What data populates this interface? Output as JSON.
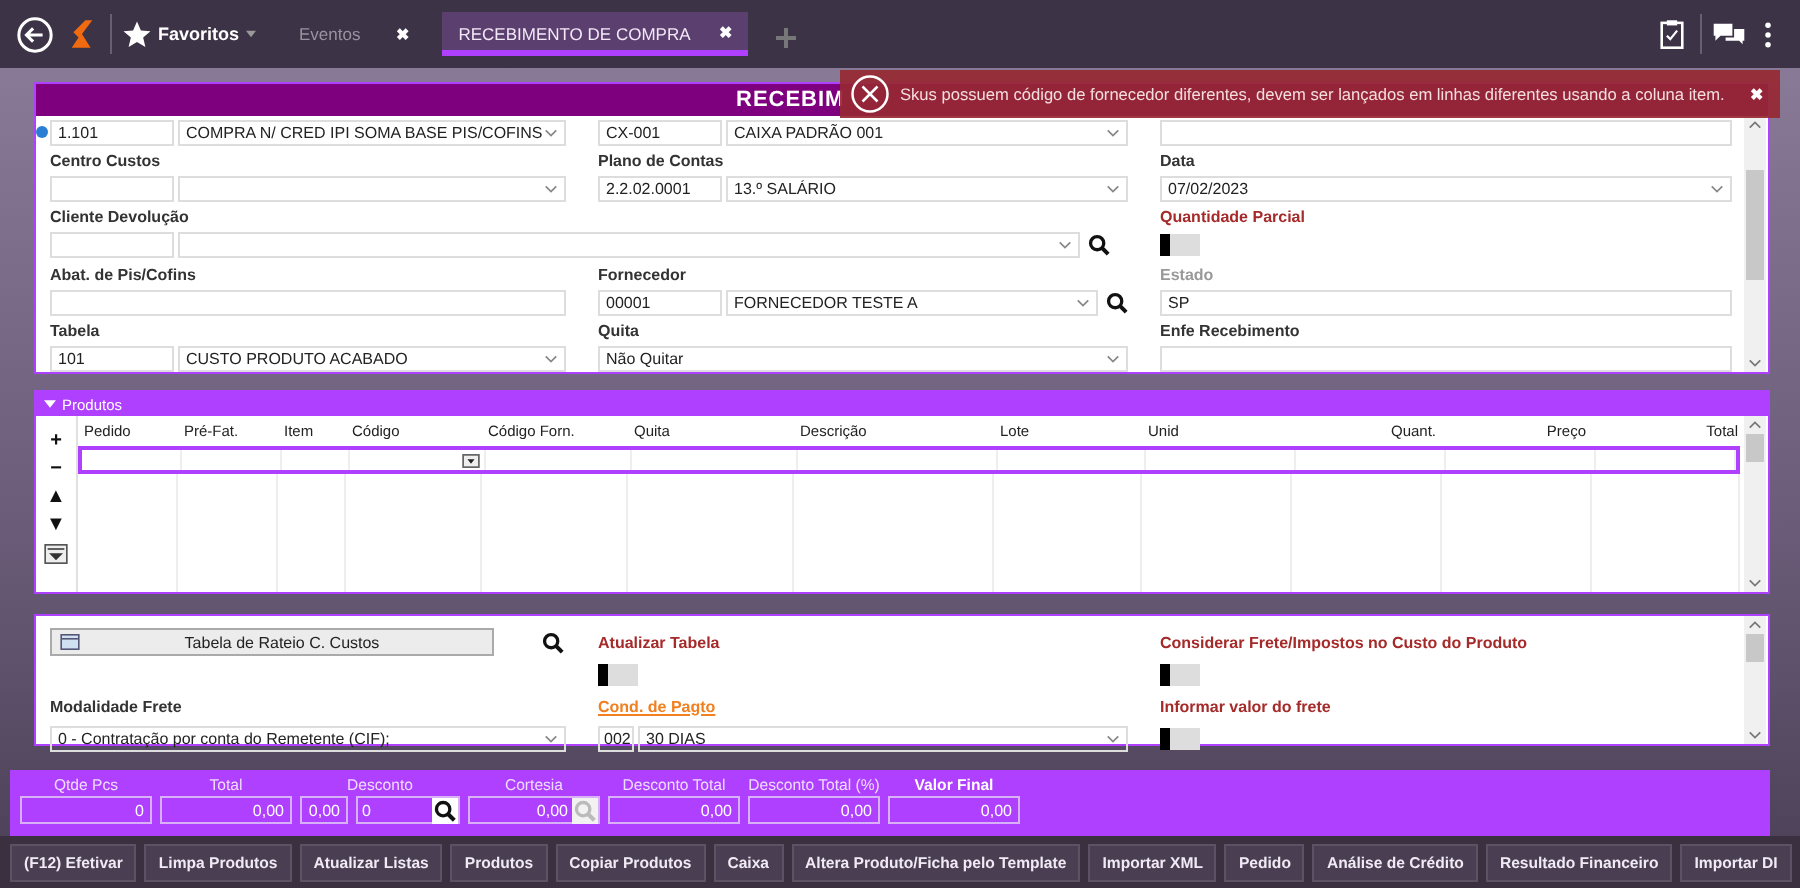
{
  "top_bar": {
    "favorites_label": "Favoritos",
    "tabs": [
      {
        "label": "Eventos",
        "selected": false,
        "close": "✖"
      },
      {
        "label": "RECEBIMENTO DE COMPRA",
        "selected": true,
        "close": "✖"
      }
    ]
  },
  "toast": {
    "message": "Skus possuem código de fornecedor diferentes, devem ser lançados em linhas diferentes usando a coluna item.",
    "close": "✖"
  },
  "form": {
    "title": "RECEBIM",
    "rows": [
      {
        "cells": [
          {
            "kind": "lookup",
            "code": "1.101",
            "value": "COMPRA N/ CRED IPI SOMA BASE PIS/COFINS",
            "info": true
          },
          {
            "kind": "lookup",
            "code": "CX-001",
            "value": "CAIXA PADRÃO 001"
          },
          {
            "kind": "input"
          }
        ]
      },
      {
        "cells": [
          {
            "kind": "label",
            "text": "Centro Custos"
          },
          {
            "kind": "label",
            "text": "Plano de Contas"
          },
          {
            "kind": "label",
            "text": "Data"
          }
        ]
      },
      {
        "cells": [
          {
            "kind": "lookup"
          },
          {
            "kind": "lookup",
            "code": "2.2.02.0001",
            "value": "13.º SALÁRIO"
          },
          {
            "kind": "select",
            "value": "07/02/2023"
          }
        ]
      },
      {
        "cells": [
          {
            "kind": "label",
            "text": "Cliente Devolução"
          },
          {
            "kind": "blank"
          },
          {
            "kind": "required_label",
            "text": "Quantidade Parcial"
          }
        ]
      },
      {
        "cells": [
          {
            "kind": "wide_lookup",
            "search": true
          },
          {
            "kind": "blank"
          },
          {
            "kind": "toggle",
            "on": false
          }
        ]
      },
      {
        "cells": [
          {
            "kind": "label",
            "text": "Abat. de Pis/Cofins"
          },
          {
            "kind": "label",
            "text": "Fornecedor"
          },
          {
            "kind": "disabled_label",
            "text": "Estado"
          }
        ]
      },
      {
        "cells": [
          {
            "kind": "input"
          },
          {
            "kind": "lookup",
            "code": "00001",
            "value": "FORNECEDOR TESTE A",
            "search": true
          },
          {
            "kind": "input",
            "value": "SP"
          }
        ]
      },
      {
        "cells": [
          {
            "kind": "label",
            "text": "Tabela"
          },
          {
            "kind": "label",
            "text": "Quita"
          },
          {
            "kind": "label",
            "text": "Enfe Recebimento"
          }
        ]
      },
      {
        "cells": [
          {
            "kind": "lookup",
            "code": "101",
            "value": "CUSTO PRODUTO ACABADO"
          },
          {
            "kind": "select",
            "value": "Não Quitar"
          },
          {
            "kind": "input"
          }
        ]
      }
    ]
  },
  "products": {
    "title": "Produtos",
    "tools": [
      "+",
      "−",
      "▲",
      "▼"
    ],
    "columns": [
      "Pedido",
      "Pré-Fat.",
      "Item",
      "Código",
      "Código Forn.",
      "Quita",
      "Descrição",
      "Lote",
      "Unid",
      "Quant.",
      "Preço",
      "Total"
    ],
    "rows": [
      {
        "selected": true
      }
    ]
  },
  "lower": {
    "rows": [
      {
        "cells": [
          {
            "kind": "button",
            "text": "Tabela de Rateio C. Custos",
            "search": true
          },
          {
            "kind": "required_label",
            "text": "Atualizar Tabela"
          },
          {
            "kind": "required_label",
            "text": "Considerar Frete/Impostos no Custo do Produto"
          }
        ]
      },
      {
        "cells": [
          {
            "kind": "blank"
          },
          {
            "kind": "toggle",
            "on": false
          },
          {
            "kind": "toggle",
            "on": false
          }
        ]
      },
      {
        "cells": [
          {
            "kind": "label",
            "text": "Modalidade Frete"
          },
          {
            "kind": "link_label",
            "text": "Cond. de Pagto"
          },
          {
            "kind": "required_label",
            "text": "Informar valor do frete"
          }
        ]
      },
      {
        "cells": [
          {
            "kind": "select",
            "value": "0 - Contratação por conta do Remetente (CIF);"
          },
          {
            "kind": "lookup",
            "code": "002",
            "value": "30 DIAS"
          },
          {
            "kind": "toggle",
            "on": false
          }
        ]
      }
    ]
  },
  "totals": [
    {
      "label": "Qtde Pcs",
      "emphasis": false,
      "fields": [
        {
          "value": "0"
        }
      ]
    },
    {
      "label": "Total",
      "emphasis": false,
      "fields": [
        {
          "value": "0,00"
        }
      ]
    },
    {
      "label": "Desconto",
      "emphasis": false,
      "fields": [
        {
          "value": "0,00"
        },
        {
          "value": "0",
          "search": true,
          "disabled": false
        }
      ]
    },
    {
      "label": "Cortesia",
      "emphasis": false,
      "fields": [
        {
          "value": "0,00",
          "search": true,
          "disabled": true
        }
      ]
    },
    {
      "label": "Desconto Total",
      "emphasis": false,
      "fields": [
        {
          "value": "0,00"
        }
      ]
    },
    {
      "label": "Desconto Total (%)",
      "emphasis": false,
      "fields": [
        {
          "value": "0,00"
        }
      ]
    },
    {
      "label": "Valor Final",
      "emphasis": true,
      "fields": [
        {
          "value": "0,00"
        }
      ]
    }
  ],
  "buttons": [
    "(F12) Efetivar",
    "Limpa Produtos",
    "Atualizar Listas",
    "Produtos",
    "Copiar Produtos",
    "Caixa",
    "Altera Produto/Ficha pelo Template",
    "Importar XML",
    "Pedido",
    "Análise de Crédito",
    "Resultado Financeiro",
    "Importar DI"
  ]
}
